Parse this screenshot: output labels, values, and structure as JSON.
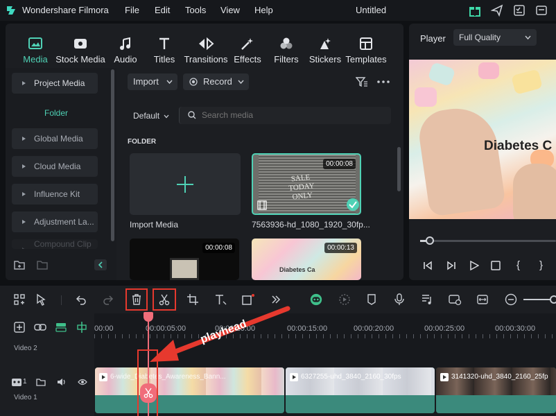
{
  "app": {
    "name": "Wondershare Filmora",
    "doc_title": "Untitled"
  },
  "menu": [
    "File",
    "Edit",
    "Tools",
    "View",
    "Help"
  ],
  "tabs": [
    {
      "label": "Media",
      "icon": "media-icon",
      "active": true
    },
    {
      "label": "Stock Media",
      "icon": "stock-media-icon"
    },
    {
      "label": "Audio",
      "icon": "music-note-icon"
    },
    {
      "label": "Titles",
      "icon": "title-t-icon"
    },
    {
      "label": "Transitions",
      "icon": "transitions-icon"
    },
    {
      "label": "Effects",
      "icon": "effects-icon"
    },
    {
      "label": "Filters",
      "icon": "filters-icon"
    },
    {
      "label": "Stickers",
      "icon": "stickers-icon"
    },
    {
      "label": "Templates",
      "icon": "templates-icon"
    }
  ],
  "sidebar": {
    "project_media": "Project Media",
    "folder": "Folder",
    "items": [
      "Global Media",
      "Cloud Media",
      "Influence Kit",
      "Adjustment La...",
      "Compound Clip"
    ]
  },
  "media_toolbar": {
    "import": "Import",
    "record": "Record",
    "sort": "Default",
    "search_placeholder": "Search media"
  },
  "folder_heading": "FOLDER",
  "media_items": [
    {
      "label": "Import Media"
    },
    {
      "label": "7563936-hd_1080_1920_30fp...",
      "duration": "00:00:08",
      "sign_text": "SALE TODAY ONLY"
    },
    {
      "label": "",
      "duration": "00:00:08"
    },
    {
      "label": "",
      "duration": "00:00:13",
      "overlay_text": "Diabetes Ca"
    }
  ],
  "player": {
    "title": "Player",
    "quality": "Full Quality",
    "overlay_text": "Diabetes C",
    "progress": 0.05
  },
  "timeline": {
    "ruler": [
      "00:00",
      "00:00:05:00",
      "00:00:10:00",
      "00:00:15:00",
      "00:00:20:00",
      "00:00:25:00",
      "00:00:30:00"
    ],
    "tracks": [
      {
        "label": "Video 2"
      },
      {
        "label": "Video 1",
        "count": "1"
      }
    ],
    "clips": [
      {
        "name": "6-wide_Diabetes_Awareness_Bann..."
      },
      {
        "name": "6327255-uhd_3840_2160_30fps"
      },
      {
        "name": "3141320-uhd_3840_2160_25fp"
      }
    ]
  },
  "annotation": {
    "label": "playhead"
  },
  "colors": {
    "accent": "#4fd1b5",
    "highlight": "#e6392e",
    "playhead": "#f06d7a",
    "clip": "#3b8a7c"
  }
}
